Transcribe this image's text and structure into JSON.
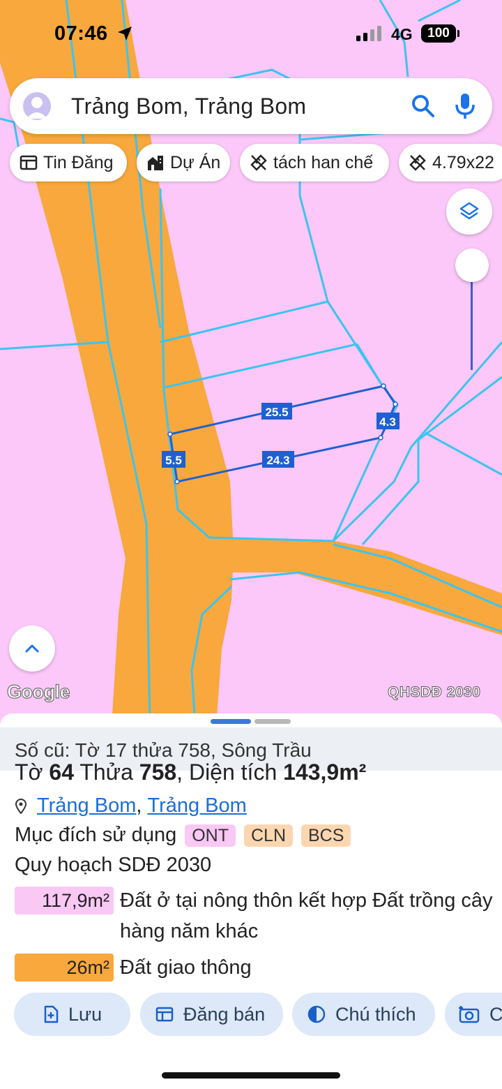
{
  "status_bar": {
    "time": "07:46",
    "network": "4G",
    "battery": "100"
  },
  "search": {
    "text": "Trảng Bom, Trảng Bom"
  },
  "chips": [
    {
      "label": "Tin Đăng",
      "icon": "newspaper-icon"
    },
    {
      "label": "Dự Án",
      "icon": "building-icon"
    },
    {
      "label": "tách han chế",
      "icon": "ruler-icon"
    },
    {
      "label": "4.79x22",
      "icon": "ruler-icon"
    }
  ],
  "map": {
    "parcel_edges": {
      "top": "25.5",
      "bottom": "24.3",
      "left": "5.5",
      "right": "4.3"
    },
    "attribution": "Google",
    "layer_label": "QHSDĐ 2030",
    "colors": {
      "land": "#fbc8f9",
      "road": "#f8a83c",
      "parcel_lines": "#3cc4f0",
      "selected": "#1f5fd0"
    }
  },
  "details": {
    "old_number": "Số cũ: Tờ 17 thửa 758, Sông Trầu",
    "title_prefix": "Tờ",
    "sheet": "64",
    "plot_label": "Thửa",
    "plot": "758",
    "area_label": ", Diện tích",
    "area": "143,9m²",
    "address": [
      "Trảng Bom",
      "Trảng Bom"
    ],
    "address_sep": ",",
    "usage_label": "Mục đích sử dụng",
    "usage_tags": [
      "ONT",
      "CLN",
      "BCS"
    ],
    "plan_label": "Quy hoạch SDĐ 2030",
    "plan_rows": [
      {
        "area": "117,9m²",
        "desc": "Đất ở tại nông thôn kết hợp Đất trồng cây hàng năm khác",
        "color": "#f9c8f4"
      },
      {
        "area": "26m²",
        "desc": "Đất giao thông",
        "color": "#f8a83c"
      }
    ]
  },
  "actions": [
    {
      "label": "Lưu",
      "icon": "bookmark-add-icon"
    },
    {
      "label": "Đăng bán",
      "icon": "listing-icon"
    },
    {
      "label": "Chú thích",
      "icon": "contrast-icon"
    },
    {
      "label": "C",
      "icon": "camera-icon"
    }
  ]
}
